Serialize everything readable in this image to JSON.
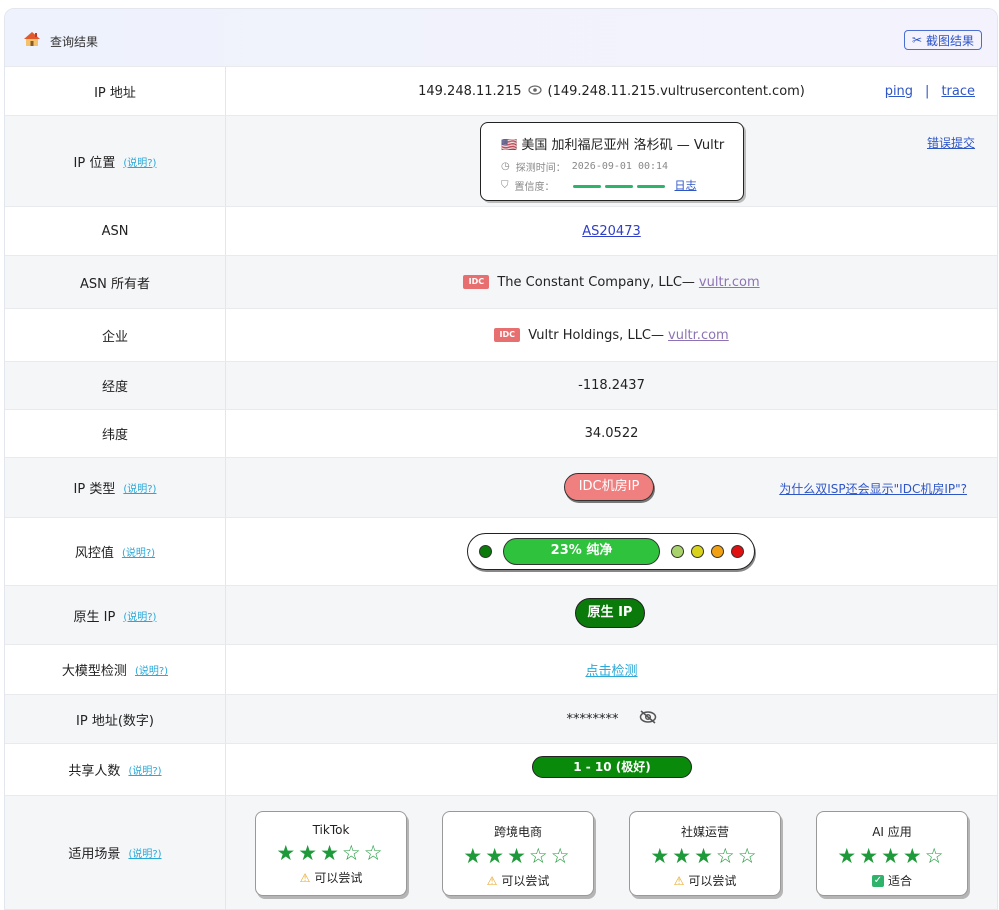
{
  "header": {
    "title": "查询结果",
    "screenshot_label": "截图结果"
  },
  "help_label": "(说明?)",
  "rows": {
    "ip": {
      "label": "IP 地址",
      "ip": "149.248.11.215",
      "host": "(149.248.11.215.vultrusercontent.com)",
      "ping": "ping",
      "sep": "|",
      "trace": "trace"
    },
    "location": {
      "label": "IP 位置",
      "flag": "🇺🇸",
      "text": "美国 加利福尼亚州 洛杉矶 — Vultr",
      "time_label": "探测时间：",
      "time": "2026-09-01 00:14",
      "conf_label": "置信度：",
      "log_link": "日志",
      "report": "错误提交"
    },
    "asn": {
      "label": "ASN",
      "value": "AS20473"
    },
    "asn_owner": {
      "label": "ASN 所有者",
      "badge": "IDC",
      "name": "The Constant Company, LLC—",
      "domain": "vultr.com"
    },
    "company": {
      "label": "企业",
      "badge": "IDC",
      "name": "Vultr Holdings, LLC—",
      "domain": "vultr.com"
    },
    "longitude": {
      "label": "经度",
      "value": "-118.2437"
    },
    "latitude": {
      "label": "纬度",
      "value": "34.0522"
    },
    "ip_type": {
      "label": "IP 类型",
      "value": "IDC机房IP",
      "why_link": "为什么双ISP还会显示\"IDC机房IP\"?"
    },
    "risk": {
      "label": "风控值",
      "value": "23%  纯净",
      "percent": 23
    },
    "native": {
      "label": "原生 IP",
      "value": "原生 IP"
    },
    "llm": {
      "label": "大模型检测",
      "link": "点击检测"
    },
    "ip_numeric": {
      "label": "IP 地址(数字)",
      "value": "********"
    },
    "shared": {
      "label": "共享人数",
      "value": "1 - 10 (极好)"
    },
    "scenes": {
      "label": "适用场景",
      "items": [
        {
          "title": "TikTok",
          "stars": 3,
          "status": "可以尝试",
          "status_type": "warn"
        },
        {
          "title": "跨境电商",
          "stars": 3,
          "status": "可以尝试",
          "status_type": "warn"
        },
        {
          "title": "社媒运营",
          "stars": 3,
          "status": "可以尝试",
          "status_type": "warn"
        },
        {
          "title": "AI 应用",
          "stars": 4,
          "status": "适合",
          "status_type": "ok"
        }
      ]
    }
  },
  "colors": {
    "accent": "#2f56c6",
    "green": "#2fc23d",
    "idc_red": "#e86f6f"
  }
}
